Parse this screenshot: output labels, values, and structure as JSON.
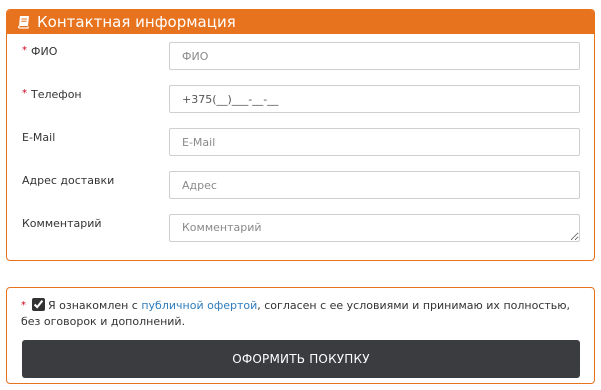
{
  "contact": {
    "header_title": "Контактная информация",
    "fields": [
      {
        "label": "ФИО",
        "required": true,
        "placeholder": "ФИО",
        "value": ""
      },
      {
        "label": "Телефон",
        "required": true,
        "placeholder": "",
        "value": "+375(__)___-__-__"
      },
      {
        "label": "E-Mail",
        "required": false,
        "placeholder": "E-Mail",
        "value": ""
      },
      {
        "label": "Адрес доставки",
        "required": false,
        "placeholder": "Адрес",
        "value": ""
      },
      {
        "label": "Комментарий",
        "required": false,
        "placeholder": "Комментарий",
        "value": ""
      }
    ]
  },
  "agreement": {
    "required_mark": "*",
    "text_before": "Я ознакомлен с ",
    "link_text": "публичной офертой",
    "text_after": ", согласен с ее условиями и принимаю их полностью, без оговорок и дополнений.",
    "checked": true
  },
  "submit_label": "ОФОРМИТЬ ПОКУПКУ",
  "colors": {
    "accent": "#e8731f",
    "required": "#d0021b",
    "link": "#2f7dbd",
    "button": "#3a3c40"
  },
  "icons": {
    "header_icon": "book-icon"
  }
}
